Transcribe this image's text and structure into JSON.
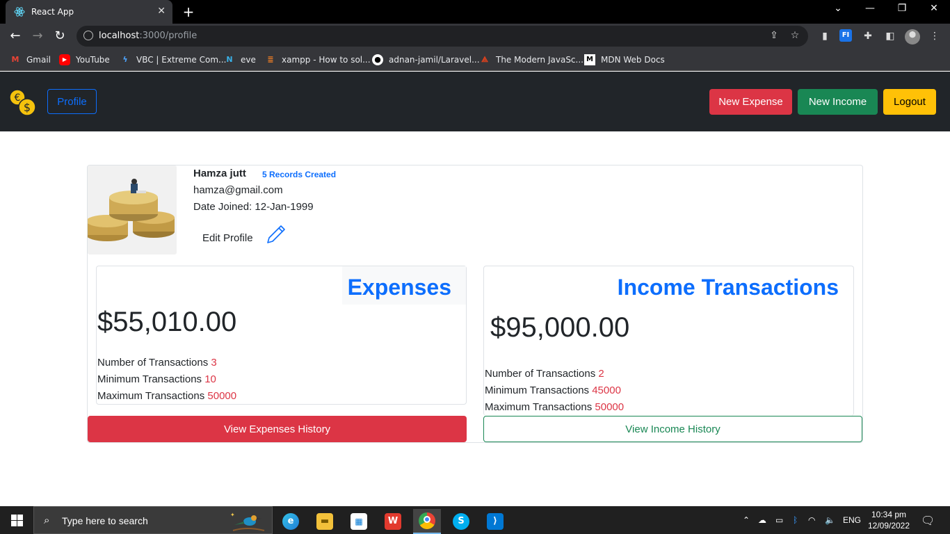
{
  "browser": {
    "tab_title": "React App",
    "url_host": "localhost",
    "url_path": ":3000/profile",
    "bookmarks": [
      {
        "label": "Gmail",
        "icon": "gmail-icon"
      },
      {
        "label": "YouTube",
        "icon": "youtube-icon"
      },
      {
        "label": "VBC | Extreme Com...",
        "icon": "vbc-icon"
      },
      {
        "label": "eve",
        "icon": "eve-icon"
      },
      {
        "label": "xampp - How to sol...",
        "icon": "stackoverflow-icon"
      },
      {
        "label": "adnan-jamil/Laravel...",
        "icon": "github-icon"
      },
      {
        "label": "The Modern JavaSc...",
        "icon": "javascript-info-icon"
      },
      {
        "label": "MDN Web Docs",
        "icon": "mdn-icon"
      }
    ]
  },
  "navbar": {
    "profile_label": "Profile",
    "new_expense_label": "New Expense",
    "new_income_label": "New Income",
    "logout_label": "Logout"
  },
  "profile": {
    "name": "Hamza jutt",
    "records": "5 Records Created",
    "email": "hamza@gmail.com",
    "date_joined": "Date Joined: 12-Jan-1999",
    "edit_label": "Edit Profile"
  },
  "expenses": {
    "title": "Expenses",
    "amount": "$55,010.00",
    "count_label": "Number of Transactions",
    "count_value": "3",
    "min_label": "Minimum Transactions",
    "min_value": "10",
    "max_label": "Maximum Transactions",
    "max_value": "50000",
    "history_label": "View Expenses History"
  },
  "income": {
    "title": "Income Transactions",
    "amount": "$95,000.00",
    "count_label": "Number of Transactions",
    "count_value": "2",
    "min_label": "Minimum Transactions",
    "min_value": "45000",
    "max_label": "Maximum Transactions",
    "max_value": "50000",
    "history_label": "View Income History"
  },
  "taskbar": {
    "search_placeholder": "Type here to search",
    "language": "ENG",
    "time": "10:34 pm",
    "date": "12/09/2022"
  },
  "colors": {
    "danger": "#dc3545",
    "success": "#198754",
    "warning": "#ffc107",
    "primary": "#0d6efd",
    "navbar_bg": "#212529"
  }
}
